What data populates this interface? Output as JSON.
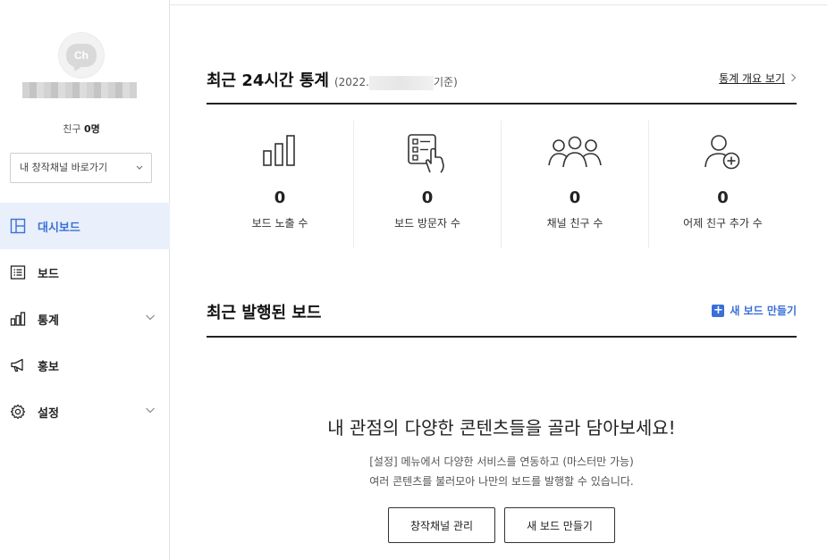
{
  "sidebar": {
    "friend_label": "친구",
    "friend_count": "0명",
    "channel_select": "내 창작채널 바로가기",
    "nav": [
      {
        "label": "대시보드",
        "icon": "dashboard-icon",
        "active": true
      },
      {
        "label": "보드",
        "icon": "board-list-icon"
      },
      {
        "label": "통계",
        "icon": "bar-chart-icon",
        "expandable": true
      },
      {
        "label": "홍보",
        "icon": "megaphone-icon"
      },
      {
        "label": "설정",
        "icon": "gear-icon",
        "expandable": true
      }
    ]
  },
  "stats_section": {
    "title": "최근 24시간 통계",
    "date_prefix": "(2022.",
    "date_suffix": "기준)",
    "overview_link": "통계 개요 보기",
    "items": [
      {
        "value": "0",
        "label": "보드 노출 수",
        "icon": "bar-chart-icon"
      },
      {
        "value": "0",
        "label": "보드 방문자 수",
        "icon": "tap-list-icon"
      },
      {
        "value": "0",
        "label": "채널 친구 수",
        "icon": "group-icon"
      },
      {
        "value": "0",
        "label": "어제 친구 추가 수",
        "icon": "add-user-icon"
      }
    ]
  },
  "boards_section": {
    "title": "최근 발행된 보드",
    "new_board_link": "새 보드 만들기",
    "empty_title": "내 관점의 다양한 콘텐츠들을 골라 담아보세요!",
    "empty_desc_line1": "[설정] 메뉴에서 다양한 서비스를 연동하고 (마스터만 가능)",
    "empty_desc_line2": "여러 콘텐츠를 불러모아 나만의 보드를 발행할 수 있습니다.",
    "manage_button": "창작채널 관리",
    "new_board_button": "새 보드 만들기"
  },
  "colors": {
    "accent": "#3a6fd8",
    "active_bg": "#e9f0fb"
  }
}
